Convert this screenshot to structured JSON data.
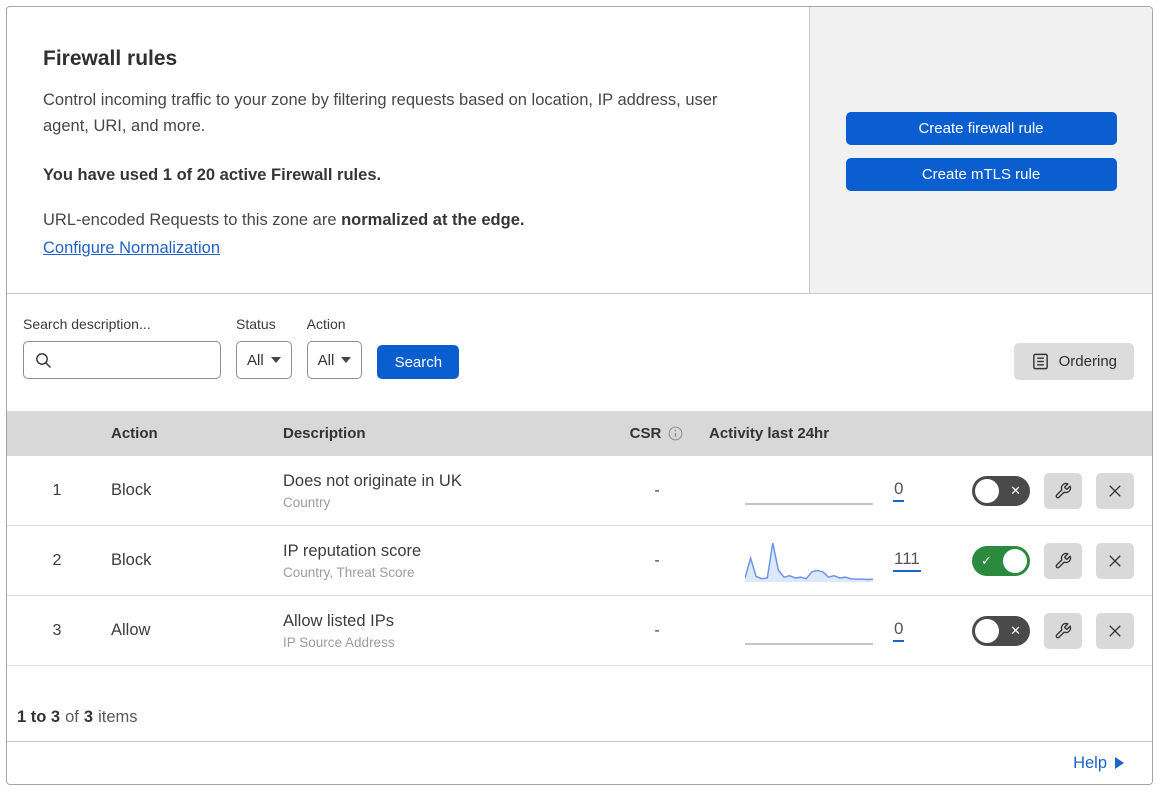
{
  "colors": {
    "accent": "#0b5ecf",
    "link": "#2262c6",
    "toggle_on": "#2b8a3e",
    "toggle_off": "#4a4a4a",
    "spark_line": "#6b96e8",
    "spark_fill": "#dde8fa",
    "header_bg": "#d8d8d8"
  },
  "icons": {
    "search": "magnifier",
    "dropdown": "caret-down",
    "ordering": "list-document",
    "csr_info": "info-circle",
    "edit": "wrench",
    "delete": "x-cross",
    "help_arrow": "triangle-right",
    "toggle_on_mark": "✓",
    "toggle_off_mark": "✕"
  },
  "header": {
    "title": "Firewall rules",
    "description": "Control incoming traffic to your zone by filtering requests based on location, IP address, user agent, URI, and more.",
    "usage_bold": "You have used 1 of 20 active Firewall rules.",
    "normalization_prefix": "URL-encoded Requests to this zone are ",
    "normalization_bold": "normalized at the edge.",
    "normalization_link": "Configure Normalization"
  },
  "actions_panel": {
    "create_firewall_rule": "Create firewall rule",
    "create_mtls_rule": "Create mTLS rule"
  },
  "filters": {
    "search_label": "Search description...",
    "status_label": "Status",
    "status_value": "All",
    "action_label": "Action",
    "action_value": "All",
    "search_button": "Search",
    "ordering_button": "Ordering"
  },
  "table": {
    "headers": {
      "action": "Action",
      "description": "Description",
      "csr": "CSR",
      "activity": "Activity last 24hr"
    },
    "rows": [
      {
        "number": "1",
        "action": "Block",
        "description": "Does not originate in UK",
        "fields": "Country",
        "csr": "-",
        "activity_count": "0",
        "enabled": false,
        "sparkline": []
      },
      {
        "number": "2",
        "action": "Block",
        "description": "IP reputation score",
        "fields": "Country, Threat Score",
        "csr": "-",
        "activity_count": "111",
        "enabled": true,
        "sparkline": [
          8,
          60,
          12,
          6,
          8,
          100,
          28,
          10,
          14,
          8,
          10,
          6,
          24,
          28,
          24,
          10,
          14,
          8,
          10,
          6,
          5,
          5,
          4,
          5
        ]
      },
      {
        "number": "3",
        "action": "Allow",
        "description": "Allow listed IPs",
        "fields": "IP Source Address",
        "csr": "-",
        "activity_count": "0",
        "enabled": false,
        "sparkline": []
      }
    ]
  },
  "footer": {
    "range_bold": "1 to 3",
    "of_text": "of",
    "total_bold": "3",
    "items_text": "items",
    "help_label": "Help"
  }
}
